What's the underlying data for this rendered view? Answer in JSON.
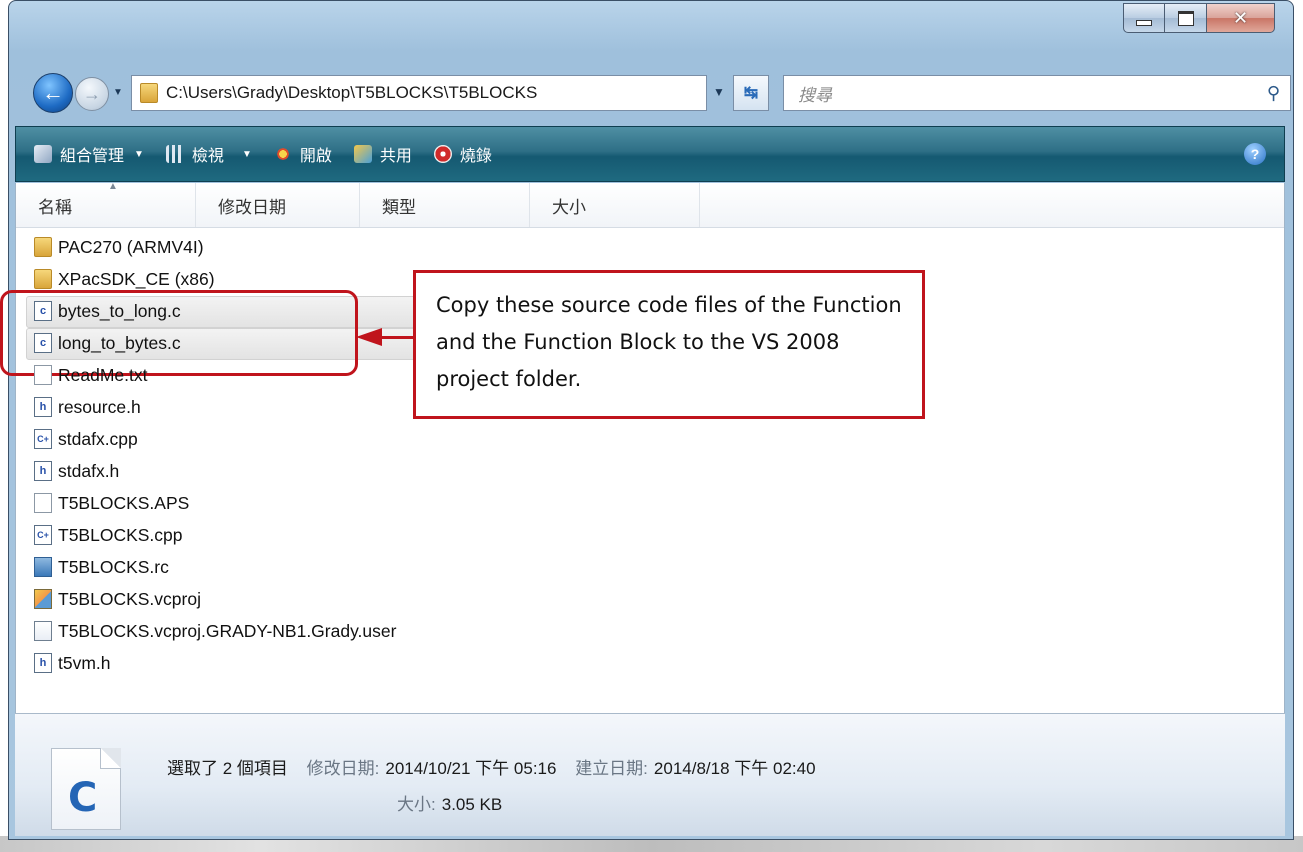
{
  "window": {
    "minimize": "",
    "maximize": "",
    "close": "✕"
  },
  "address": {
    "path": "C:\\Users\\Grady\\Desktop\\T5BLOCKS\\T5BLOCKS",
    "search_placeholder": "搜尋"
  },
  "toolbar": {
    "organize": "組合管理",
    "views": "檢視",
    "open": "開啟",
    "share": "共用",
    "burn": "燒錄",
    "help": "?"
  },
  "columns": {
    "name": "名稱",
    "modified": "修改日期",
    "type": "類型",
    "size": "大小"
  },
  "files": [
    {
      "name": "PAC270 (ARMV4I)",
      "icon": "folder-icon"
    },
    {
      "name": "XPacSDK_CE (x86)",
      "icon": "folder-icon"
    },
    {
      "name": "bytes_to_long.c",
      "icon": "c-file-icon"
    },
    {
      "name": "long_to_bytes.c",
      "icon": "c-file-icon"
    },
    {
      "name": "ReadMe.txt",
      "icon": "text-file-icon"
    },
    {
      "name": "resource.h",
      "icon": "header-file-icon"
    },
    {
      "name": "stdafx.cpp",
      "icon": "cpp-file-icon"
    },
    {
      "name": "stdafx.h",
      "icon": "header-file-icon"
    },
    {
      "name": "T5BLOCKS.APS",
      "icon": "blank-file-icon"
    },
    {
      "name": "T5BLOCKS.cpp",
      "icon": "cpp-file-icon"
    },
    {
      "name": "T5BLOCKS.rc",
      "icon": "resource-file-icon"
    },
    {
      "name": "T5BLOCKS.vcproj",
      "icon": "project-file-icon"
    },
    {
      "name": "T5BLOCKS.vcproj.GRADY-NB1.Grady.user",
      "icon": "user-file-icon"
    },
    {
      "name": "t5vm.h",
      "icon": "header-file-icon"
    }
  ],
  "callout": {
    "text": "Copy these source code files of the Function and the Function Block to the VS 2008 project folder."
  },
  "details": {
    "selected": "選取了 2 個項目",
    "modified_label": "修改日期:",
    "modified_value": "2014/10/21 下午 05:16",
    "created_label": "建立日期:",
    "created_value": "2014/8/18 下午 02:40",
    "size_label": "大小:",
    "size_value": "3.05 KB",
    "thumb_letter": "C"
  },
  "colors": {
    "accent_red": "#c0141c",
    "toolbar": "#1f6a80"
  }
}
